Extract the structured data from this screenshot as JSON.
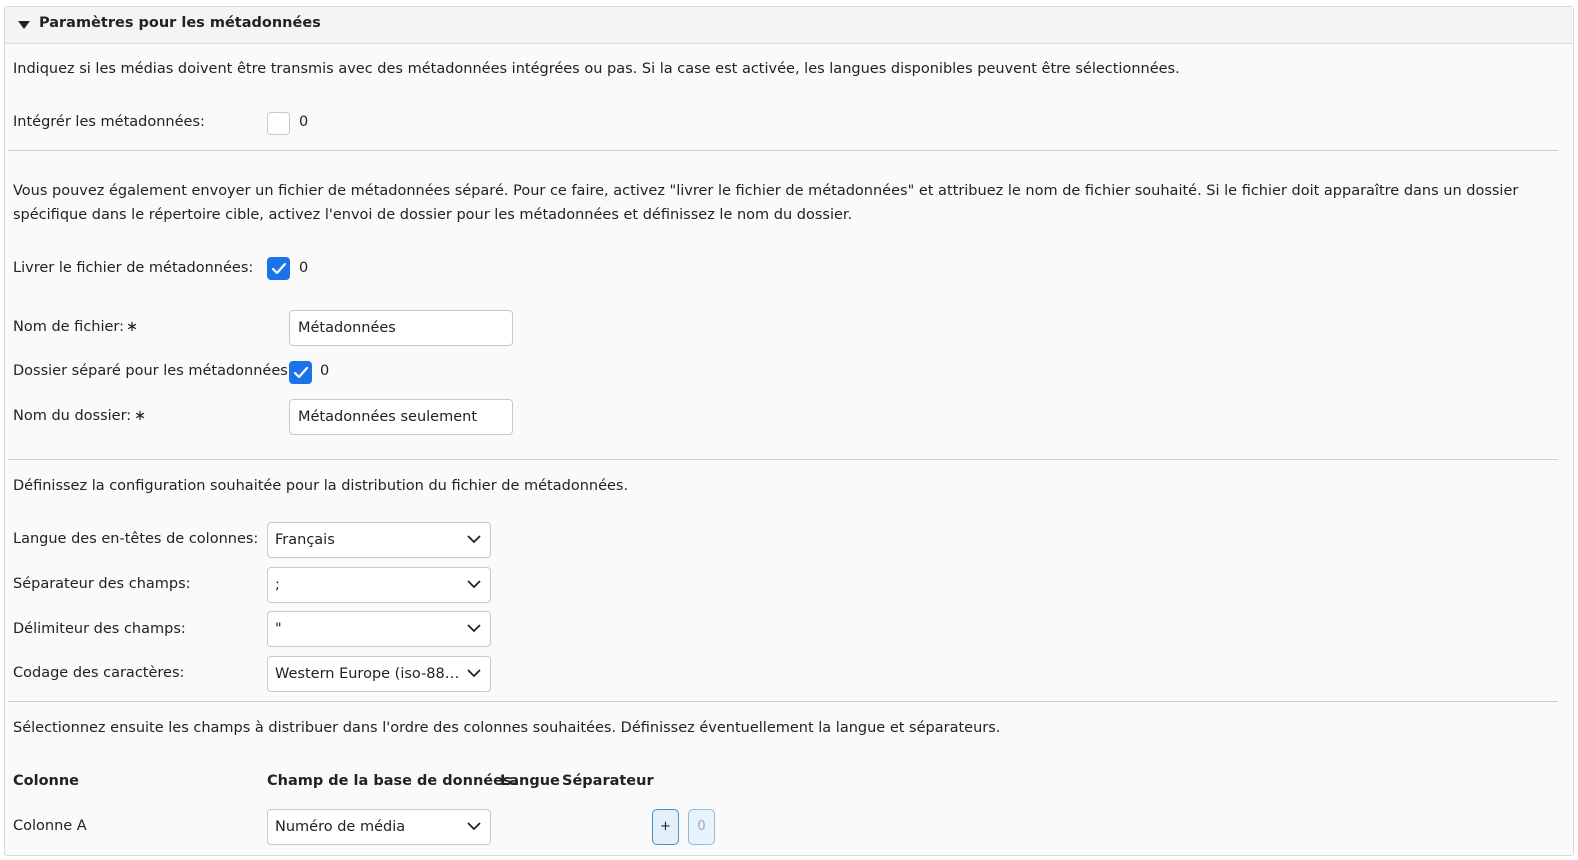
{
  "section": {
    "title": "Paramètres pour les métadonnées"
  },
  "embed": {
    "description": "Indiquez si les médias doivent être transmis avec des métadonnées intégrées ou pas. Si la case est activée, les langues disponibles peuvent être sélectionnées.",
    "label": "Intégrér les métadonnées:",
    "value": "0"
  },
  "separate_file": {
    "description": "Vous pouvez également envoyer un fichier de métadonnées séparé. Pour ce faire, activez \"livrer le fichier de métadonnées\" et attribuez le nom de fichier souhaité. Si le fichier doit apparaître dans un dossier spécifique dans le répertoire cible, activez l'envoi de dossier pour les métadonnées et définissez le nom du dossier.",
    "deliver_label": "Livrer le fichier de métadonnées:",
    "deliver_value": "0",
    "filename_label": "Nom de fichier:",
    "filename_value": "Métadonnées",
    "folder_toggle_label": "Dossier séparé pour les métadonnées:",
    "folder_toggle_value": "0",
    "folder_label": "Nom du dossier:",
    "folder_value": "Métadonnées seulement",
    "required_mark": "∗"
  },
  "distribution": {
    "description": "Définissez la configuration souhaitée pour la distribution du fichier de métadonnées.",
    "language_label": "Langue des en-têtes de colonnes:",
    "language_value": "Français",
    "separator_label": "Séparateur des champs:",
    "separator_value": ";",
    "delimiter_label": "Délimiteur des champs:",
    "delimiter_value": "\"",
    "encoding_label": "Codage des caractères:",
    "encoding_value": "Western Europe (iso-885..."
  },
  "columns": {
    "description": "Sélectionnez ensuite les champs à distribuer dans l'ordre des colonnes souhaitées. Définissez éventuellement la langue et séparateurs.",
    "headers": {
      "column": "Colonne",
      "db_field": "Champ de la base de données.",
      "language": "Langue",
      "separator": "Séparateur"
    },
    "rows": [
      {
        "column": "Colonne A",
        "db_field": "Numéro de média"
      }
    ],
    "add_label": "+",
    "count_label": "0"
  },
  "colors": {
    "accent": "#1a73e8",
    "border": "#c8c8c8"
  }
}
